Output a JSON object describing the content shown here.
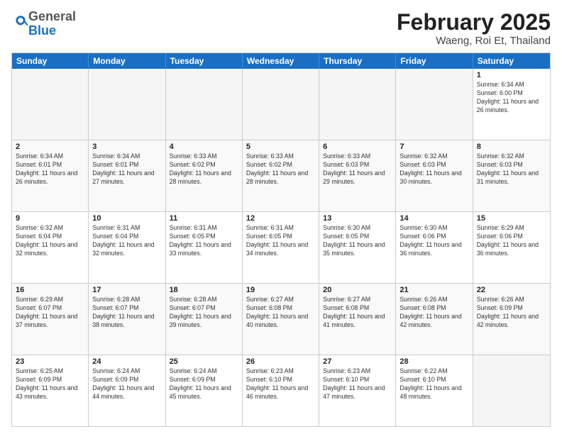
{
  "logo": {
    "general": "General",
    "blue": "Blue"
  },
  "title": "February 2025",
  "subtitle": "Waeng, Roi Et, Thailand",
  "days": [
    "Sunday",
    "Monday",
    "Tuesday",
    "Wednesday",
    "Thursday",
    "Friday",
    "Saturday"
  ],
  "weeks": [
    [
      {
        "day": "",
        "info": ""
      },
      {
        "day": "",
        "info": ""
      },
      {
        "day": "",
        "info": ""
      },
      {
        "day": "",
        "info": ""
      },
      {
        "day": "",
        "info": ""
      },
      {
        "day": "",
        "info": ""
      },
      {
        "day": "1",
        "info": "Sunrise: 6:34 AM\nSunset: 6:00 PM\nDaylight: 11 hours\nand 26 minutes."
      }
    ],
    [
      {
        "day": "2",
        "info": "Sunrise: 6:34 AM\nSunset: 6:01 PM\nDaylight: 11 hours\nand 26 minutes."
      },
      {
        "day": "3",
        "info": "Sunrise: 6:34 AM\nSunset: 6:01 PM\nDaylight: 11 hours\nand 27 minutes."
      },
      {
        "day": "4",
        "info": "Sunrise: 6:33 AM\nSunset: 6:02 PM\nDaylight: 11 hours\nand 28 minutes."
      },
      {
        "day": "5",
        "info": "Sunrise: 6:33 AM\nSunset: 6:02 PM\nDaylight: 11 hours\nand 28 minutes."
      },
      {
        "day": "6",
        "info": "Sunrise: 6:33 AM\nSunset: 6:03 PM\nDaylight: 11 hours\nand 29 minutes."
      },
      {
        "day": "7",
        "info": "Sunrise: 6:32 AM\nSunset: 6:03 PM\nDaylight: 11 hours\nand 30 minutes."
      },
      {
        "day": "8",
        "info": "Sunrise: 6:32 AM\nSunset: 6:03 PM\nDaylight: 11 hours\nand 31 minutes."
      }
    ],
    [
      {
        "day": "9",
        "info": "Sunrise: 6:32 AM\nSunset: 6:04 PM\nDaylight: 11 hours\nand 32 minutes."
      },
      {
        "day": "10",
        "info": "Sunrise: 6:31 AM\nSunset: 6:04 PM\nDaylight: 11 hours\nand 32 minutes."
      },
      {
        "day": "11",
        "info": "Sunrise: 6:31 AM\nSunset: 6:05 PM\nDaylight: 11 hours\nand 33 minutes."
      },
      {
        "day": "12",
        "info": "Sunrise: 6:31 AM\nSunset: 6:05 PM\nDaylight: 11 hours\nand 34 minutes."
      },
      {
        "day": "13",
        "info": "Sunrise: 6:30 AM\nSunset: 6:05 PM\nDaylight: 11 hours\nand 35 minutes."
      },
      {
        "day": "14",
        "info": "Sunrise: 6:30 AM\nSunset: 6:06 PM\nDaylight: 11 hours\nand 36 minutes."
      },
      {
        "day": "15",
        "info": "Sunrise: 6:29 AM\nSunset: 6:06 PM\nDaylight: 11 hours\nand 36 minutes."
      }
    ],
    [
      {
        "day": "16",
        "info": "Sunrise: 6:29 AM\nSunset: 6:07 PM\nDaylight: 11 hours\nand 37 minutes."
      },
      {
        "day": "17",
        "info": "Sunrise: 6:28 AM\nSunset: 6:07 PM\nDaylight: 11 hours\nand 38 minutes."
      },
      {
        "day": "18",
        "info": "Sunrise: 6:28 AM\nSunset: 6:07 PM\nDaylight: 11 hours\nand 39 minutes."
      },
      {
        "day": "19",
        "info": "Sunrise: 6:27 AM\nSunset: 6:08 PM\nDaylight: 11 hours\nand 40 minutes."
      },
      {
        "day": "20",
        "info": "Sunrise: 6:27 AM\nSunset: 6:08 PM\nDaylight: 11 hours\nand 41 minutes."
      },
      {
        "day": "21",
        "info": "Sunrise: 6:26 AM\nSunset: 6:08 PM\nDaylight: 11 hours\nand 42 minutes."
      },
      {
        "day": "22",
        "info": "Sunrise: 6:26 AM\nSunset: 6:09 PM\nDaylight: 11 hours\nand 42 minutes."
      }
    ],
    [
      {
        "day": "23",
        "info": "Sunrise: 6:25 AM\nSunset: 6:09 PM\nDaylight: 11 hours\nand 43 minutes."
      },
      {
        "day": "24",
        "info": "Sunrise: 6:24 AM\nSunset: 6:09 PM\nDaylight: 11 hours\nand 44 minutes."
      },
      {
        "day": "25",
        "info": "Sunrise: 6:24 AM\nSunset: 6:09 PM\nDaylight: 11 hours\nand 45 minutes."
      },
      {
        "day": "26",
        "info": "Sunrise: 6:23 AM\nSunset: 6:10 PM\nDaylight: 11 hours\nand 46 minutes."
      },
      {
        "day": "27",
        "info": "Sunrise: 6:23 AM\nSunset: 6:10 PM\nDaylight: 11 hours\nand 47 minutes."
      },
      {
        "day": "28",
        "info": "Sunrise: 6:22 AM\nSunset: 6:10 PM\nDaylight: 11 hours\nand 48 minutes."
      },
      {
        "day": "",
        "info": ""
      }
    ]
  ]
}
